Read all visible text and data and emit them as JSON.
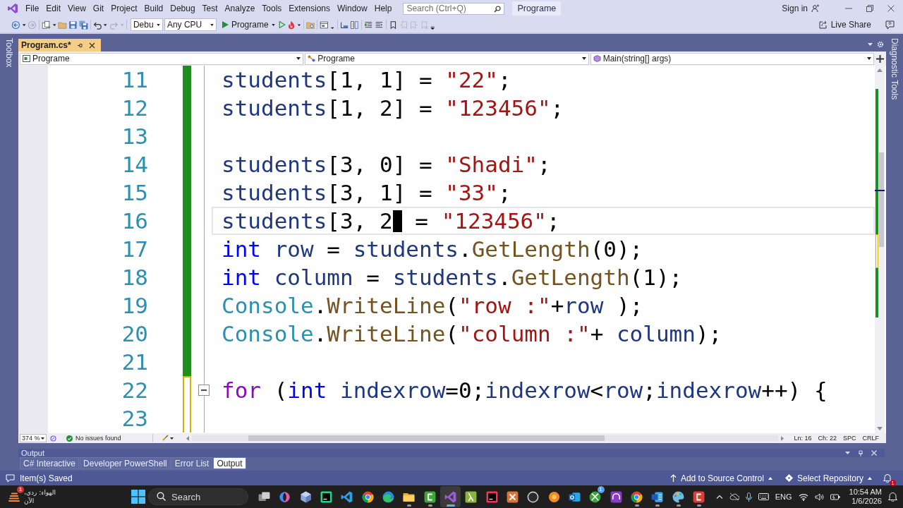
{
  "menu_bar": {
    "items": [
      "File",
      "Edit",
      "View",
      "Git",
      "Project",
      "Build",
      "Debug",
      "Test",
      "Analyze",
      "Tools",
      "Extensions",
      "Window",
      "Help"
    ],
    "search": {
      "placeholder": "Search (Ctrl+Q)"
    },
    "solution_name": "Programe",
    "sign_in": "Sign in"
  },
  "toolbar": {
    "configuration": "Debu",
    "platform": "Any CPU",
    "run_target": "Programe",
    "live_share": "Live Share"
  },
  "side_strips": {
    "left": "Toolbox",
    "right": "Diagnostic Tools"
  },
  "document_tabs": [
    {
      "label": "Program.cs*",
      "selected": true
    }
  ],
  "navigation_bar": [
    "Programe",
    "Programe",
    "Main(string[] args)"
  ],
  "editor": {
    "lines": [
      {
        "number": "11",
        "saved": true,
        "current": false,
        "collapsible": false,
        "tokens": [
          {
            "text": "students",
            "kind": "local"
          },
          {
            "text": "[1, 1] = ",
            "kind": "plain"
          },
          {
            "text": "\"22\"",
            "kind": "string"
          },
          {
            "text": ";",
            "kind": "plain"
          }
        ]
      },
      {
        "number": "12",
        "saved": true,
        "current": false,
        "collapsible": false,
        "tokens": [
          {
            "text": "students",
            "kind": "local"
          },
          {
            "text": "[1, 2] = ",
            "kind": "plain"
          },
          {
            "text": "\"123456\"",
            "kind": "string"
          },
          {
            "text": ";",
            "kind": "plain"
          }
        ]
      },
      {
        "number": "13",
        "saved": true,
        "current": false,
        "collapsible": false
      },
      {
        "number": "14",
        "saved": true,
        "current": false,
        "collapsible": false,
        "tokens": [
          {
            "text": "students",
            "kind": "local"
          },
          {
            "text": "[3, 0] = ",
            "kind": "plain"
          },
          {
            "text": "\"Shadi\"",
            "kind": "string"
          },
          {
            "text": ";",
            "kind": "plain"
          }
        ]
      },
      {
        "number": "15",
        "saved": true,
        "current": false,
        "collapsible": false,
        "tokens": [
          {
            "text": "students",
            "kind": "local"
          },
          {
            "text": "[3, 1] = ",
            "kind": "plain"
          },
          {
            "text": "\"33\"",
            "kind": "string"
          },
          {
            "text": ";",
            "kind": "plain"
          }
        ]
      },
      {
        "number": "16",
        "saved": true,
        "current": true,
        "collapsible": false,
        "tokens": [
          {
            "text": "students",
            "kind": "local"
          },
          {
            "text": "[3, 2",
            "kind": "plain"
          },
          {
            "kind": "caret"
          },
          {
            "text": " = ",
            "kind": "plain"
          },
          {
            "text": "\"123456\"",
            "kind": "string"
          },
          {
            "text": ";",
            "kind": "plain"
          }
        ]
      },
      {
        "number": "17",
        "saved": true,
        "current": false,
        "collapsible": false,
        "tokens": [
          {
            "text": "int ",
            "kind": "keyword"
          },
          {
            "text": "row",
            "kind": "local"
          },
          {
            "text": " = ",
            "kind": "plain"
          },
          {
            "text": "students",
            "kind": "local"
          },
          {
            "text": ".",
            "kind": "plain"
          },
          {
            "text": "GetLength",
            "kind": "method"
          },
          {
            "text": "(0);",
            "kind": "plain"
          }
        ]
      },
      {
        "number": "18",
        "saved": true,
        "current": false,
        "collapsible": false,
        "tokens": [
          {
            "text": "int ",
            "kind": "keyword"
          },
          {
            "text": "column",
            "kind": "local"
          },
          {
            "text": " = ",
            "kind": "plain"
          },
          {
            "text": "students",
            "kind": "local"
          },
          {
            "text": ".",
            "kind": "plain"
          },
          {
            "text": "GetLength",
            "kind": "method"
          },
          {
            "text": "(1);",
            "kind": "plain"
          }
        ]
      },
      {
        "number": "19",
        "saved": true,
        "current": false,
        "collapsible": false,
        "tokens": [
          {
            "text": "Console",
            "kind": "type"
          },
          {
            "text": ".",
            "kind": "plain"
          },
          {
            "text": "WriteLine",
            "kind": "method"
          },
          {
            "text": "(",
            "kind": "plain"
          },
          {
            "text": "\"row :\"",
            "kind": "string"
          },
          {
            "text": "+",
            "kind": "plain"
          },
          {
            "text": "row",
            "kind": "local"
          },
          {
            "text": " );",
            "kind": "plain"
          }
        ]
      },
      {
        "number": "20",
        "saved": true,
        "current": false,
        "collapsible": false,
        "tokens": [
          {
            "text": "Console",
            "kind": "type"
          },
          {
            "text": ".",
            "kind": "plain"
          },
          {
            "text": "WriteLine",
            "kind": "method"
          },
          {
            "text": "(",
            "kind": "plain"
          },
          {
            "text": "\"column :\"",
            "kind": "string"
          },
          {
            "text": "+ ",
            "kind": "plain"
          },
          {
            "text": "column",
            "kind": "local"
          },
          {
            "text": ");",
            "kind": "plain"
          }
        ]
      },
      {
        "number": "21",
        "saved": true,
        "current": false,
        "collapsible": false
      },
      {
        "number": "22",
        "saved": false,
        "current": false,
        "collapsible": true,
        "tokens": [
          {
            "text": "for",
            "kind": "control"
          },
          {
            "text": " (",
            "kind": "plain"
          },
          {
            "text": "int ",
            "kind": "keyword"
          },
          {
            "text": "indexrow",
            "kind": "local"
          },
          {
            "text": "=0;",
            "kind": "plain"
          },
          {
            "text": "indexrow",
            "kind": "local"
          },
          {
            "text": "<",
            "kind": "plain"
          },
          {
            "text": "row",
            "kind": "local"
          },
          {
            "text": ";",
            "kind": "plain"
          },
          {
            "text": "indexrow",
            "kind": "local"
          },
          {
            "text": "++) {",
            "kind": "plain"
          }
        ]
      },
      {
        "number": "23",
        "saved": false,
        "current": false,
        "collapsible": false
      }
    ]
  },
  "editor_status": {
    "zoom": "374 %",
    "issues": "No issues found",
    "line": "Ln: 16",
    "column": "Ch: 22",
    "whitespace": "SPC",
    "line_ending": "CRLF"
  },
  "output_panel": {
    "title": "Output",
    "tabs": [
      {
        "label": "C# Interactive",
        "selected": false
      },
      {
        "label": "Developer PowerShell",
        "selected": false
      },
      {
        "label": "Error List",
        "selected": false
      },
      {
        "label": "Output",
        "selected": true
      }
    ]
  },
  "status_bar": {
    "message": "Item(s) Saved",
    "source_control": "Add to Source Control",
    "repository": "Select Repository",
    "notifications": "1"
  },
  "taskbar": {
    "weather": {
      "badge": "1",
      "lines": [
        "الهواء: ردي،",
        "الآن"
      ]
    },
    "search": {
      "placeholder": "Search"
    },
    "apps": [
      {
        "running": false,
        "active": false
      },
      {
        "running": false,
        "active": false
      },
      {
        "running": false,
        "active": false
      },
      {
        "running": false,
        "active": false
      },
      {
        "running": false,
        "active": false
      },
      {
        "running": false,
        "active": false
      },
      {
        "running": false,
        "active": false
      },
      {
        "running": true,
        "active": false
      },
      {
        "running": true,
        "active": false
      },
      {
        "running": true,
        "active": true
      },
      {
        "running": false,
        "active": false
      },
      {
        "running": false,
        "active": false
      },
      {
        "running": false,
        "active": false
      },
      {
        "running": false,
        "active": false
      },
      {
        "running": false,
        "active": false
      },
      {
        "running": false,
        "active": false
      },
      {
        "running": false,
        "active": false,
        "badge": "1"
      },
      {
        "running": false,
        "active": false
      },
      {
        "running": true,
        "active": false
      },
      {
        "running": true,
        "active": false
      },
      {
        "running": true,
        "active": false
      },
      {
        "running": true,
        "active": false
      }
    ],
    "language": "ENG",
    "time": "10:54 AM",
    "date": "1/6/2026"
  }
}
